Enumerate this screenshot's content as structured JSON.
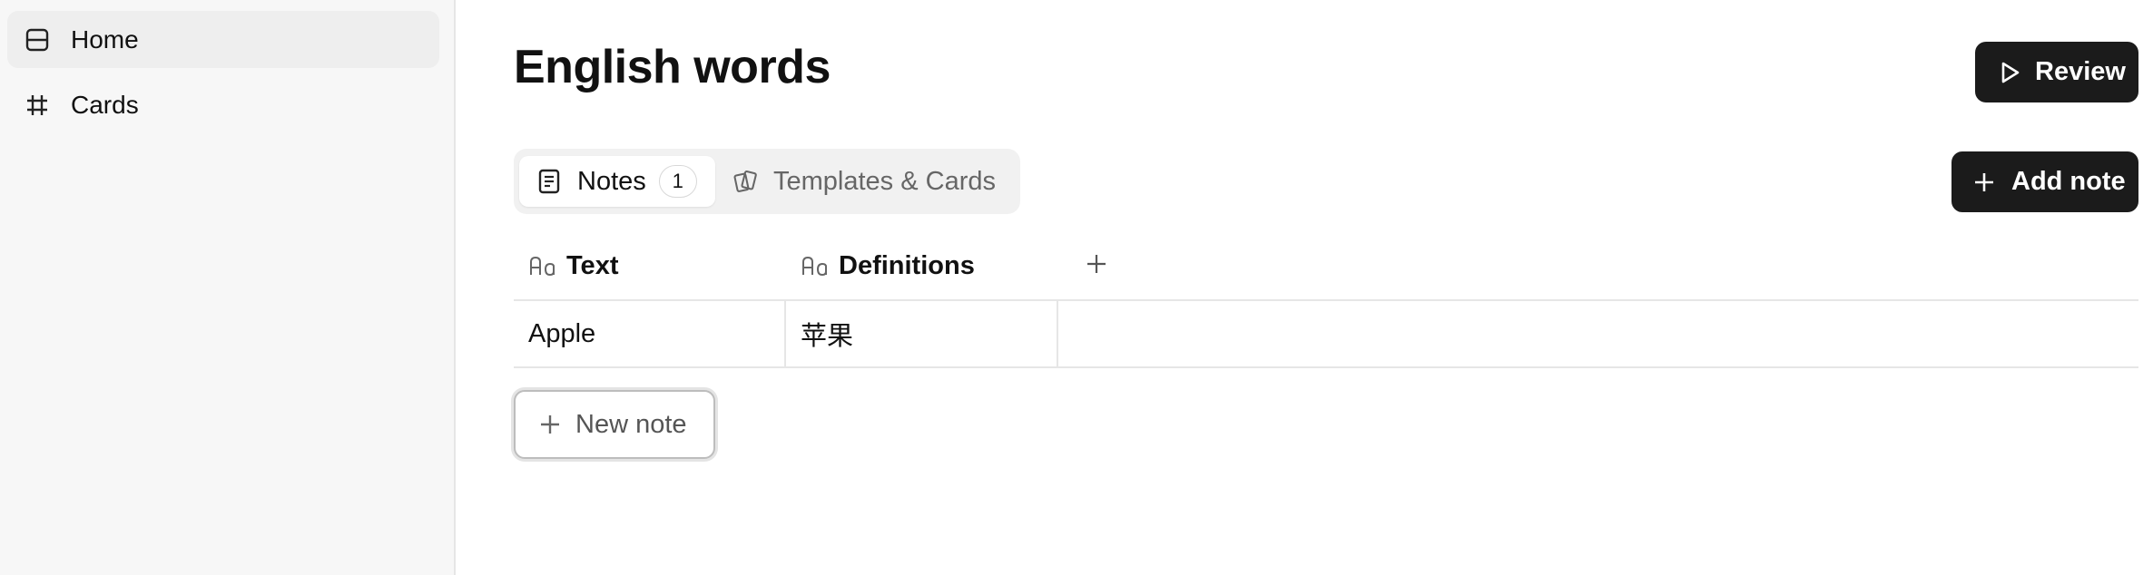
{
  "sidebar": {
    "items": [
      {
        "label": "Home",
        "icon": "home-panel-icon",
        "active": true
      },
      {
        "label": "Cards",
        "icon": "hash-icon",
        "active": false
      }
    ]
  },
  "page": {
    "title": "English words",
    "review_label": "Review",
    "add_note_label": "Add note"
  },
  "tabs": [
    {
      "label": "Notes",
      "count": "1",
      "icon": "note-icon",
      "active": true
    },
    {
      "label": "Templates & Cards",
      "icon": "cards-icon",
      "active": false
    }
  ],
  "table": {
    "columns": [
      {
        "label": "Text",
        "icon": "text-type-icon"
      },
      {
        "label": "Definitions",
        "icon": "text-type-icon"
      }
    ],
    "rows": [
      [
        "Apple",
        "苹果"
      ]
    ]
  },
  "new_note_label": "New note",
  "colors": {
    "accent_dark": "#1b1b1b",
    "sidebar_bg": "#f7f7f7"
  }
}
